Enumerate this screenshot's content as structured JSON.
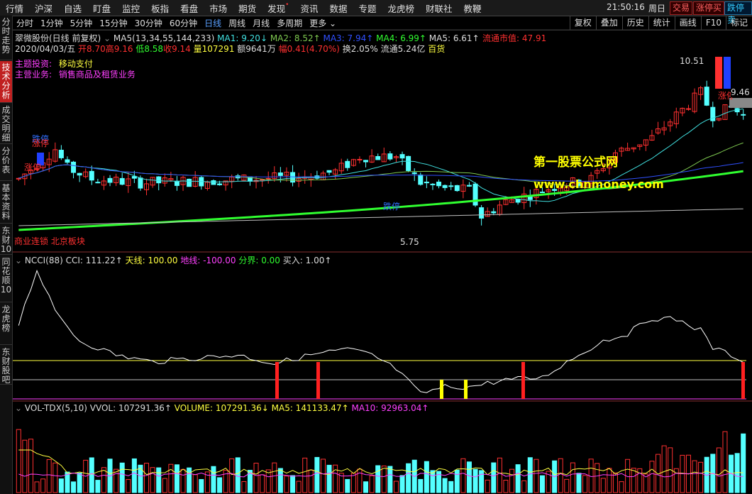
{
  "menu": [
    "行情",
    "沪深",
    "自选",
    "盯盘",
    "监控",
    "板指",
    "看盘",
    "市场",
    "期货",
    "发现",
    "资讯",
    "数据",
    "专题",
    "龙虎榜",
    "财联社",
    "教鞭"
  ],
  "menu_dot_index": 9,
  "clock": "21:50:16",
  "weekday": "周日",
  "top_buttons": [
    "交易",
    "涨停买",
    "跌停卖"
  ],
  "sidebar_tabs": [
    "分时走势",
    "技术分析",
    "成交明细",
    "分价表",
    "基本资料",
    "东财10",
    "同花顺10",
    "龙虎榜",
    "东财股吧"
  ],
  "sidebar_active": 1,
  "periods": [
    "分时",
    "1分钟",
    "5分钟",
    "15分钟",
    "30分钟",
    "60分钟",
    "日线",
    "周线",
    "月线",
    "多周期",
    "更多"
  ],
  "period_active": 6,
  "toolbar_right": [
    "复权",
    "叠加",
    "历史",
    "统计",
    "画线",
    "F10",
    "标记"
  ],
  "stock": {
    "name": "翠微股份(日线 前复权)",
    "ma_label": "MA5(13,34,55,144,233)",
    "ma1": "MA1: 9.20↓",
    "ma2": "MA2: 8.52↑",
    "ma3": "MA3: 7.94↑",
    "ma4": "MA4: 6.99↑",
    "ma5": "MA5: 6.61↑",
    "market_cap": "流通市值: 47.91",
    "date": "2020/04/03/五",
    "open": "开8.70",
    "high": "高9.16",
    "low": "低8.58",
    "close": "收9.14",
    "volume": "量107291",
    "amount": "额9641万",
    "amplitude": "幅0.41(4.70%)",
    "turnover": "换2.05%",
    "float": "流通5.24亿",
    "industry": "百货"
  },
  "concepts": {
    "theme_label": "主题投资:",
    "theme_value": "移动支付",
    "business_label": "主营业务:",
    "business_value": "销售商品及租赁业务"
  },
  "annotations": {
    "zt1": "涨停",
    "zt2": "涨停",
    "dt1": "跌停",
    "dt2": "跌停",
    "zt3": "涨停",
    "dt3": "跌停",
    "high_price": "10.51",
    "low_price": "5.75",
    "right_price": "9.46",
    "sector": "商业连锁 北京板块",
    "watermark1": "第一股票公式网",
    "watermark2": "www.chnmoney.com"
  },
  "ncci": {
    "title": "NCCI(88)",
    "cci": "CCI: 111.22↑",
    "sky": "天线: 100.00",
    "ground": "地线: -100.00",
    "divider": "分界: 0.00",
    "buy": "买入: 1.00↑"
  },
  "vol": {
    "title": "VOL-TDX(5,10)",
    "vvol": "VVOL: 107291.36↑",
    "volume": "VOLUME: 107291.36↓",
    "ma5": "MA5: 141133.47↑",
    "ma10": "MA10: 92963.04↑"
  },
  "colors": {
    "up": "#ff3030",
    "down": "#54ffff",
    "ma1": "#40e0e0",
    "ma2": "#7ec850",
    "ma3": "#3050ff",
    "ma4": "#30ff30",
    "ma5": "#c0c0c0",
    "cci_line": "#ffffff",
    "sky": "#ffff40",
    "buy_bar_red": "#ff2020",
    "buy_bar_yellow": "#ffff00"
  }
}
